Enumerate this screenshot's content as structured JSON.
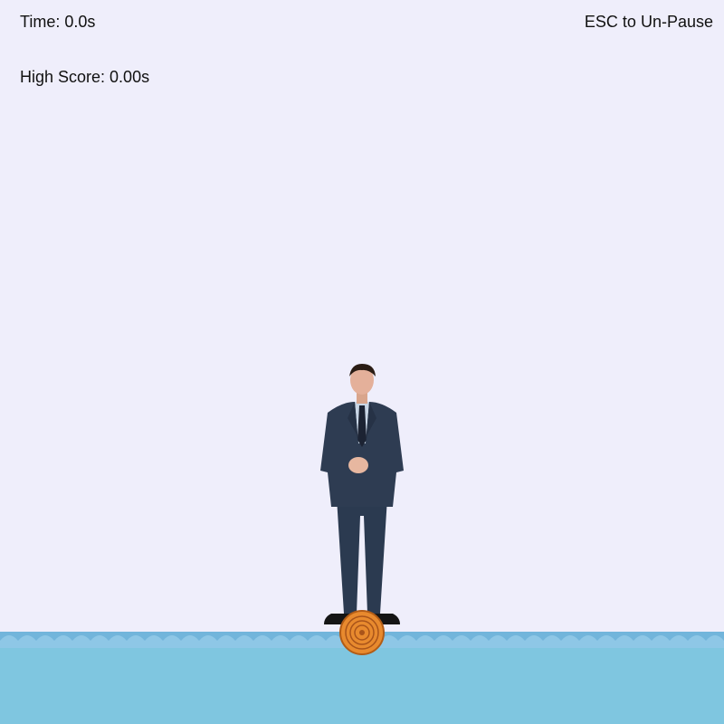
{
  "hud": {
    "time_text": "Time: 0.0s",
    "high_score_text": "High Score: 0.00s",
    "pause_hint_text": "ESC to Un-Pause"
  },
  "game": {
    "paused": true,
    "time_seconds": 0.0,
    "high_score_seconds": 0.0
  },
  "sprites": {
    "player": "man-in-suit-sprite",
    "log": "rolling-log-icon"
  },
  "colors": {
    "background": "#efeefb",
    "water": "#7fc6e0",
    "wave_band": "#72b5db",
    "log": "#e88a2e",
    "suit": "#2e3c52"
  }
}
